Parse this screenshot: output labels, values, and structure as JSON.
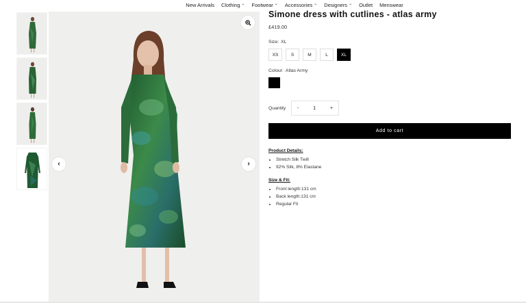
{
  "nav": {
    "items": [
      {
        "label": "New Arrivals",
        "has_dropdown": false
      },
      {
        "label": "Clothing",
        "has_dropdown": true
      },
      {
        "label": "Footwear",
        "has_dropdown": true
      },
      {
        "label": "Accessories",
        "has_dropdown": true
      },
      {
        "label": "Designers",
        "has_dropdown": true
      },
      {
        "label": "Outlet",
        "has_dropdown": false
      },
      {
        "label": "Menswear",
        "has_dropdown": false
      }
    ],
    "dropdown_icon": "chevron-down-icon"
  },
  "gallery": {
    "thumbnail_count": 4,
    "zoom_icon": "magnifier-icon",
    "prev_icon": "chevron-left-icon",
    "next_icon": "chevron-right-icon"
  },
  "product": {
    "title": "Simone dress with cutlines - atlas army",
    "price": "£419.00",
    "size_label": "Size:",
    "size_selected": "XL",
    "sizes": [
      "XS",
      "S",
      "M",
      "L",
      "XL"
    ],
    "colour_label": "Colour:",
    "colour_selected": "Atlas Army",
    "colour_swatch_hex": "#000000",
    "quantity_label": "Quantity",
    "quantity_minus": "-",
    "quantity_value": "1",
    "quantity_plus": "+",
    "add_to_cart": "Add to cart",
    "details_heading": "Product Details:",
    "details": [
      "Stretch Silk Twill",
      "92% Silk, 8% Elastane"
    ],
    "fit_heading": "Size & Fit:",
    "fit": [
      "Front length:131 cm",
      "Back length:131 cm",
      "Regular Fit"
    ]
  },
  "colors": {
    "accent": "#000000",
    "dress_green": "#2f6b3a",
    "background": "#efefed"
  }
}
